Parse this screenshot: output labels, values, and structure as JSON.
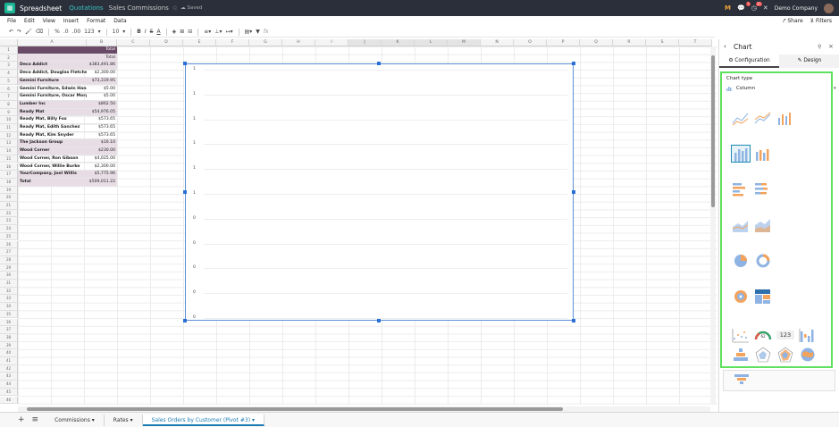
{
  "navbar": {
    "app_name": "Spreadsheet",
    "breadcrumb_module": "Quotations",
    "breadcrumb_doc": "Sales Commissions",
    "saved_label": "Saved",
    "msg_badge": "5",
    "activity_badge": "35",
    "company": "Demo Company"
  },
  "menu": {
    "file": "File",
    "edit": "Edit",
    "view": "View",
    "insert": "Insert",
    "format": "Format",
    "data": "Data",
    "share": "Share",
    "filters": "Filters"
  },
  "toolbar": {
    "percent": "%",
    "dec_less": ".0",
    "dec_more": ".00",
    "format": "123",
    "font_size": "10",
    "bold": "B",
    "italic": "I",
    "strike": "S",
    "underline_a": "A",
    "fx": "fx"
  },
  "columns": [
    "A",
    "B",
    "C",
    "D",
    "E",
    "F",
    "G",
    "H",
    "I",
    "J",
    "K",
    "L",
    "M",
    "N",
    "O",
    "P",
    "Q",
    "R",
    "S",
    "T"
  ],
  "row_numbers": [
    "1",
    "2",
    "3",
    "4",
    "5",
    "6",
    "7",
    "8",
    "9",
    "10",
    "11",
    "12",
    "13",
    "14",
    "15",
    "16",
    "17",
    "18",
    "19",
    "20",
    "21",
    "22",
    "23",
    "24",
    "25",
    "26",
    "27",
    "28",
    "29",
    "30",
    "31",
    "32",
    "33",
    "34",
    "35",
    "36",
    "37",
    "38",
    "39",
    "40",
    "41",
    "42",
    "43",
    "44",
    "45",
    "46"
  ],
  "pivot": {
    "header1_b": "Total",
    "header2_b": "Total",
    "rows": [
      {
        "label": "Deco Addict",
        "value": "$383,491.86",
        "group": true
      },
      {
        "label": "Deco Addict, Douglas Fletcher",
        "value": "$2,300.00",
        "group": false
      },
      {
        "label": "Gemini Furniture",
        "value": "$73,319.95",
        "group": true
      },
      {
        "label": "Gemini Furniture, Edwin Hansen",
        "value": "$5.00",
        "group": false
      },
      {
        "label": "Gemini Furniture, Oscar Morgan",
        "value": "$5.00",
        "group": false
      },
      {
        "label": "Lumber Inc",
        "value": "$862.50",
        "group": true
      },
      {
        "label": "Ready Mat",
        "value": "$54,976.05",
        "group": true
      },
      {
        "label": "Ready Mat, Billy Fox",
        "value": "$573.65",
        "group": false
      },
      {
        "label": "Ready Mat, Edith Sanchez",
        "value": "$573.65",
        "group": false
      },
      {
        "label": "Ready Mat, Kim Snyder",
        "value": "$573.65",
        "group": false
      },
      {
        "label": "The Jackson Group",
        "value": "$16.10",
        "group": true
      },
      {
        "label": "Wood Corner",
        "value": "$230.00",
        "group": true
      },
      {
        "label": "Wood Corner, Ron Gibson",
        "value": "$4,025.00",
        "group": false
      },
      {
        "label": "Wood Corner, Willie Burke",
        "value": "$2,300.00",
        "group": false
      },
      {
        "label": "YourCompany, Joel Willis",
        "value": "$5,775.96",
        "group": true
      }
    ],
    "total_label": "Total",
    "total_value": "$509,011.22"
  },
  "chart": {
    "y_labels": [
      "1",
      "1",
      "1",
      "1",
      "1",
      "1",
      "0",
      "0",
      "0",
      "0",
      "0"
    ]
  },
  "sheets": {
    "tab1": "Commissions",
    "tab2": "Rates",
    "tab3": "Sales Orders by Customer (Pivot #3)"
  },
  "panel": {
    "title": "Chart",
    "tab_config": "Configuration",
    "tab_design": "Design",
    "chart_type_label": "Chart type",
    "chart_type_value": "Column",
    "gauge_value": "62",
    "scorecard_text": "123"
  },
  "colors": {
    "navbar_bg": "#2b2f3a",
    "accent": "#1a7bb3",
    "highlight_border": "#5fe05f",
    "pivot_header": "#6a4a66"
  }
}
